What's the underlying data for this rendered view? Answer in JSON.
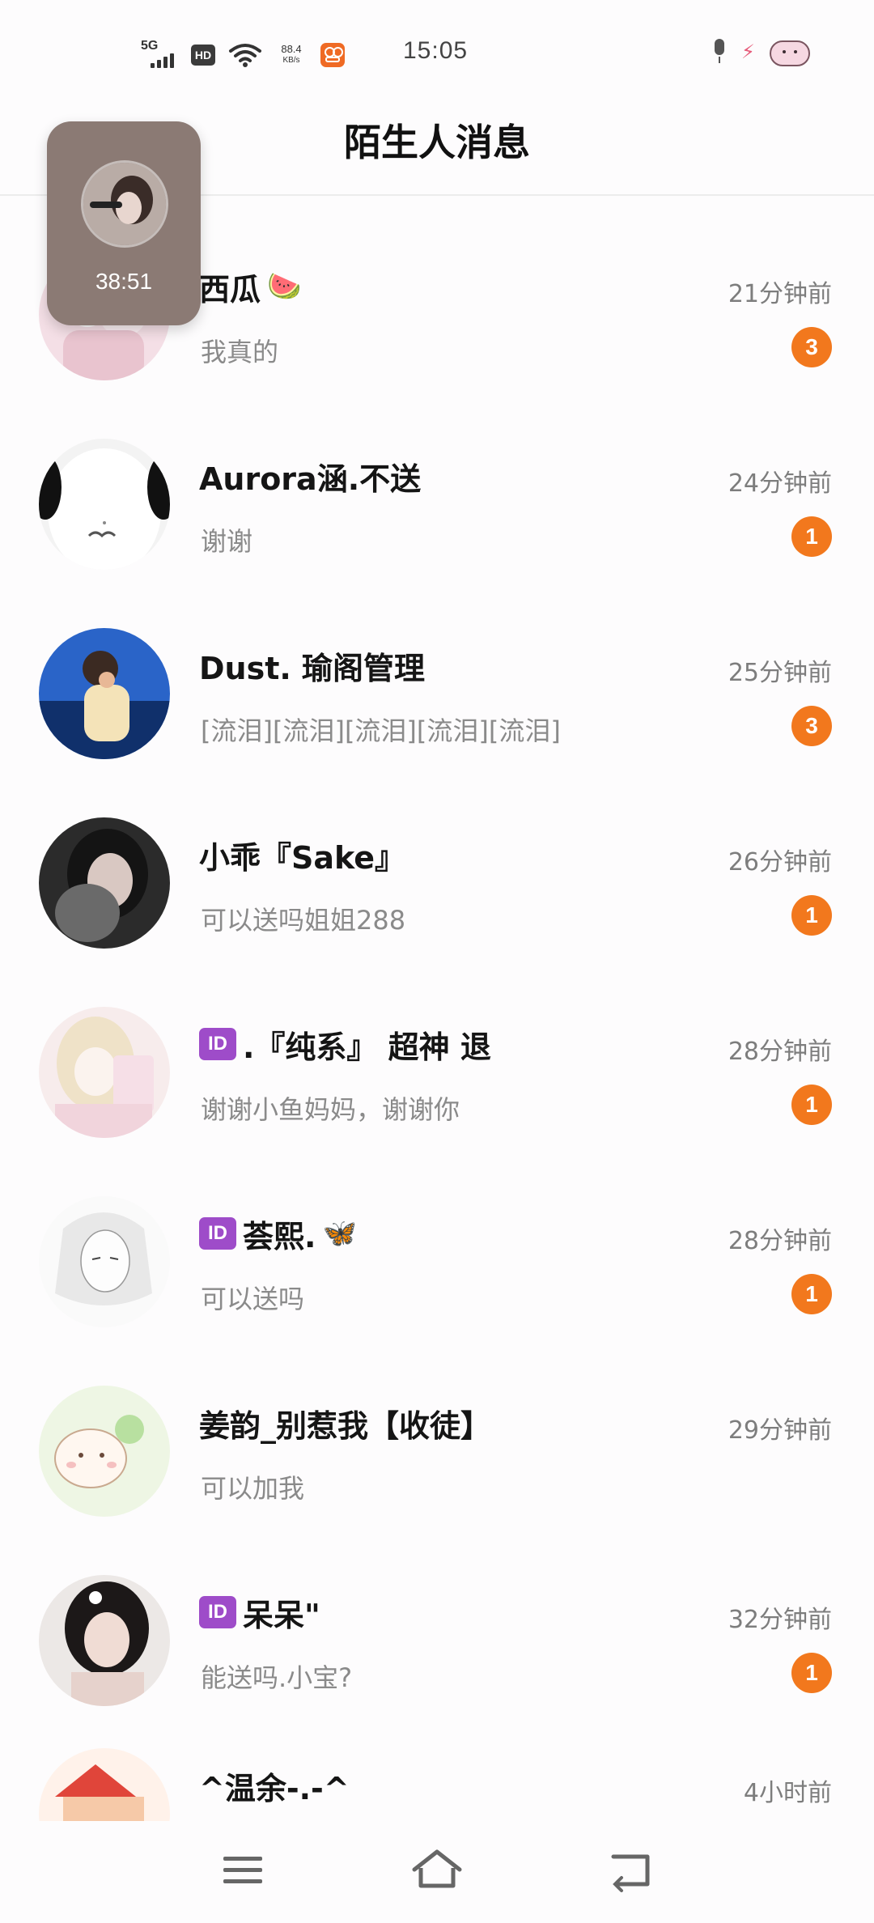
{
  "status_bar": {
    "network": "5G",
    "hd": "HD",
    "speed_value": "88.4",
    "speed_unit": "KB/s",
    "time": "15:05"
  },
  "header": {
    "title": "陌生人消息"
  },
  "float_call": {
    "timer": "38:51"
  },
  "conversations": [
    {
      "name": "西瓜",
      "emoji": "🍉",
      "id_badge": false,
      "time": "21分钟前",
      "preview": "我真的",
      "unread": "3"
    },
    {
      "name": "Aurora涵.不送",
      "emoji": "",
      "id_badge": false,
      "time": "24分钟前",
      "preview": "谢谢",
      "unread": "1"
    },
    {
      "name": "Dust. 瑜阁管理",
      "emoji": "",
      "id_badge": false,
      "time": "25分钟前",
      "preview": "[流泪][流泪][流泪][流泪][流泪]",
      "unread": "3"
    },
    {
      "name": "小乖『Sake』",
      "emoji": "",
      "id_badge": false,
      "time": "26分钟前",
      "preview": "可以送吗姐姐288",
      "unread": "1"
    },
    {
      "name": ".『纯系』 超神  退",
      "emoji": "",
      "id_badge": true,
      "time": "28分钟前",
      "preview": "谢谢小鱼妈妈，谢谢你",
      "unread": "1"
    },
    {
      "name": "荟熙.",
      "emoji": "🦋",
      "id_badge": true,
      "time": "28分钟前",
      "preview": "可以送吗",
      "unread": "1"
    },
    {
      "name": "姜韵_别惹我【收徒】",
      "emoji": "",
      "id_badge": false,
      "time": "29分钟前",
      "preview": "可以加我",
      "unread": ""
    },
    {
      "name": "呆呆\"",
      "emoji": "",
      "id_badge": true,
      "time": "32分钟前",
      "preview": "能送吗.小宝?",
      "unread": "1"
    },
    {
      "name": "^温余-.-^",
      "emoji": "",
      "id_badge": false,
      "time": "4小时前",
      "preview": "",
      "unread": ""
    }
  ],
  "id_badge_label": "ID",
  "colors": {
    "unread_badge": "#f2781d",
    "id_badge": "#9e4cc9",
    "time_text": "#7d7d7d",
    "preview_text": "#8a8a8a"
  },
  "icons": {
    "back": "chevron-left-icon",
    "nav_menu": "menu-icon",
    "nav_home": "home-icon",
    "nav_back": "back-icon"
  }
}
